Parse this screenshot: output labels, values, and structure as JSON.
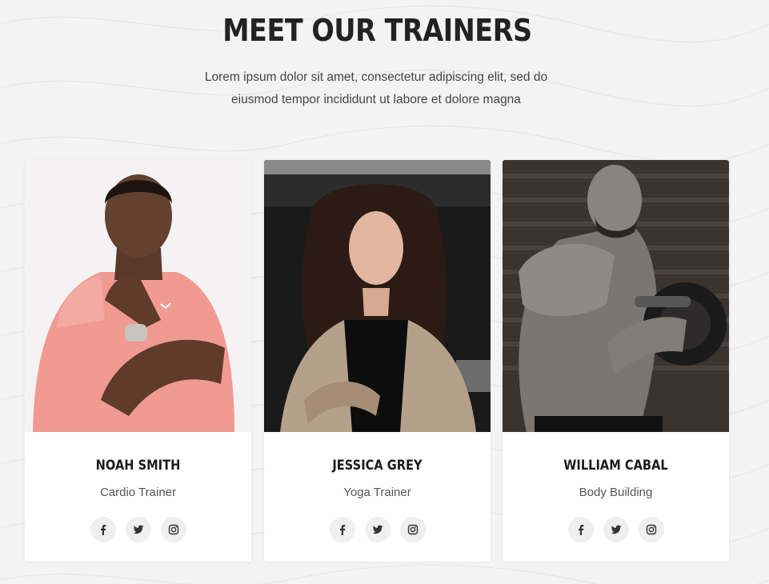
{
  "section": {
    "title": "MEET OUR TRAINERS",
    "subtitle": "Lorem ipsum dolor sit amet, consectetur adipiscing elit, sed do eiusmod tempor incididunt ut labore et dolore magna"
  },
  "trainers": [
    {
      "name": "NOAH SMITH",
      "role": "Cardio Trainer",
      "socials": [
        "facebook-icon",
        "twitter-icon",
        "instagram-icon"
      ]
    },
    {
      "name": "JESSICA GREY",
      "role": "Yoga Trainer",
      "socials": [
        "facebook-icon",
        "twitter-icon",
        "instagram-icon"
      ]
    },
    {
      "name": "WILLIAM CABAL",
      "role": "Body Building",
      "socials": [
        "facebook-icon",
        "twitter-icon",
        "instagram-icon"
      ]
    }
  ],
  "colors": {
    "background": "#f3f3f3",
    "card": "#ffffff",
    "heading": "#222222",
    "icon_bg": "#efefef"
  }
}
